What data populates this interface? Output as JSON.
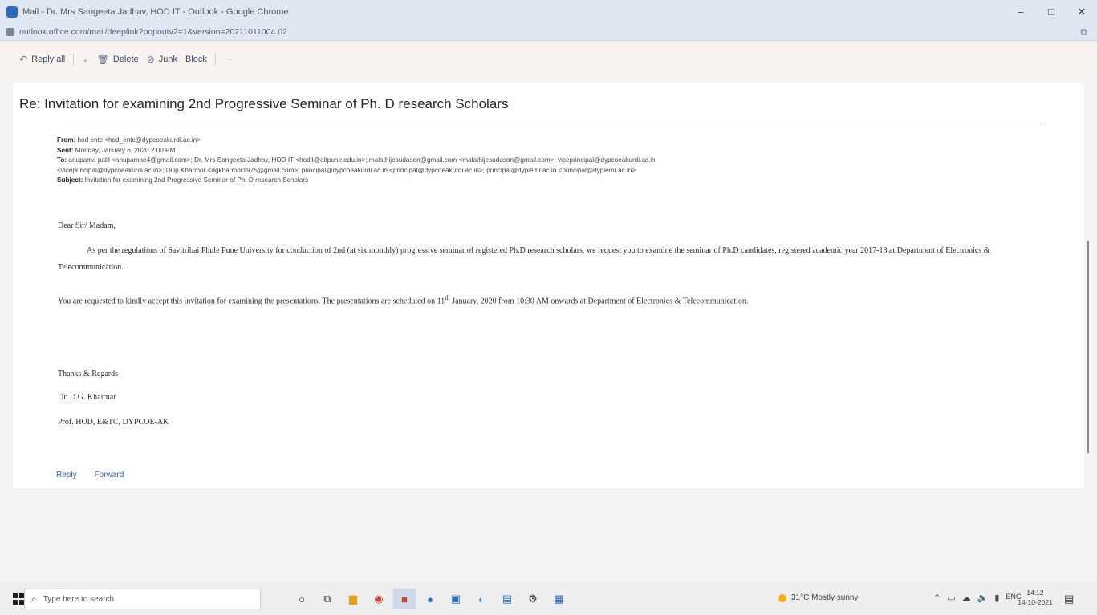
{
  "window": {
    "title": "Mail - Dr. Mrs Sangeeta Jadhav, HOD IT - Outlook - Google Chrome",
    "controls": {
      "minimize": "–",
      "maximize": "□",
      "close": "✕"
    }
  },
  "address": {
    "url": "outlook.office.com/mail/deeplink?popoutv2=1&version=20211011004.02"
  },
  "toolbar": {
    "reply_all": "Reply all",
    "delete": "Delete",
    "junk": "Junk",
    "block": "Block"
  },
  "message": {
    "subject": "Re: Invitation for examining 2nd Progressive Seminar of Ph. D research Scholars",
    "headers": {
      "from_label": "From:",
      "from": "hod entc <hod_entc@dypcoeakurdi.ac.in>",
      "sent_label": "Sent:",
      "sent": "Monday, January 6, 2020 2:00 PM",
      "to_label": "To:",
      "to_line1": "anupama patil <anupamae4@gmail.com>; Dr. Mrs Sangeeta Jadhav, HOD IT <hodit@aitpune.edu.in>; malathijesudason@gmail.com <malathijesudason@gmail.com>; viceprincipal@dypcoeakurdi.ac.in",
      "to_line2": "<viceprincipal@dypcoeakurdi.ac.in>; Dilip Kharmor <dgkharmor1975@gmail.com>; principal@dypcoeakurdi.ac.in <principal@dypcoeakurdi.ac.in>; principal@dypiemr.ac.in <principal@dypiemr.ac.in>",
      "subject_label": "Subject:",
      "subject": "Invitation for examining 2nd Progressive Seminar of Ph. D research Scholars"
    },
    "greeting": "Dear Sir/ Madam,",
    "para1": "As per the regulations of Savitribai Phule Pune University for conduction of 2nd (at six monthly) progressive seminar of registered Ph.D research scholars, we request you to examine the seminar of Ph.D candidates, registered academic year 2017-18 at Department of Electronics & Telecommunication.",
    "para2_a": "You are requested to kindly accept this invitation for examining the presentations. The presentations are scheduled on 11",
    "para2_sup": "th",
    "para2_b": " January, 2020 from 10:30 AM onwards at Department of Electronics & Telecommunication.",
    "sign1": "Thanks & Regards",
    "sign2": "Dr. D.G. Khairnar",
    "sign3": "Prof. HOD, E&TC, DYPCOE-AK",
    "reply": "Reply",
    "forward": "Forward"
  },
  "taskbar": {
    "search_placeholder": "Type here to search",
    "weather": "31°C  Mostly sunny",
    "time": "14:12",
    "date": "14-10-2021",
    "lang": "ENG"
  },
  "colors": {
    "chrome": "#dfe7f2",
    "toolbar": "#f8f3ee",
    "link": "#3565b8"
  }
}
